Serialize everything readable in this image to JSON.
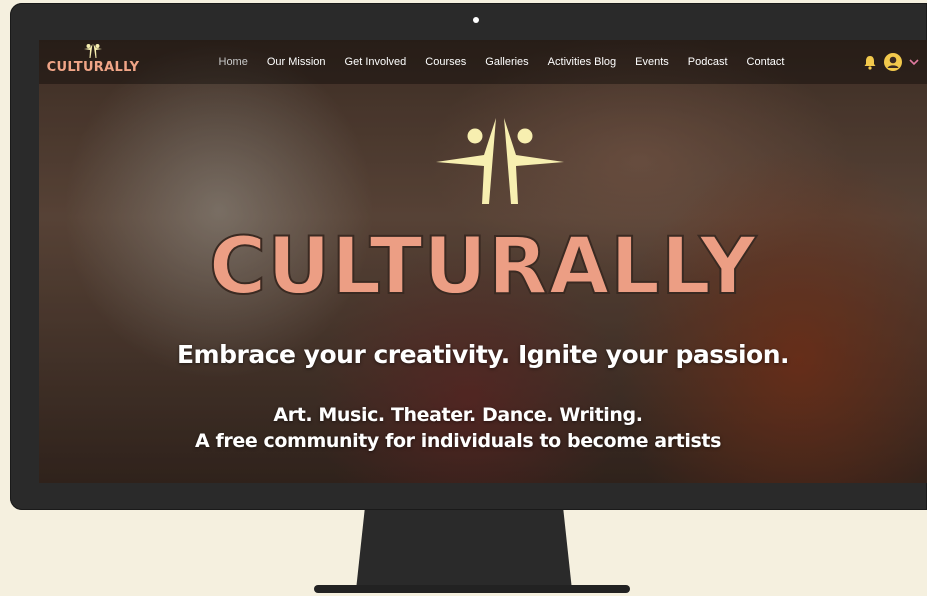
{
  "brand": {
    "name": "CULTURALLY"
  },
  "nav": {
    "items": [
      {
        "label": "Home",
        "active": true
      },
      {
        "label": "Our Mission"
      },
      {
        "label": "Get Involved"
      },
      {
        "label": "Courses"
      },
      {
        "label": "Galleries"
      },
      {
        "label": "Activities Blog"
      },
      {
        "label": "Events"
      },
      {
        "label": "Podcast"
      },
      {
        "label": "Contact"
      }
    ],
    "icons": [
      "bell-icon",
      "avatar-icon",
      "chevron-down-icon"
    ]
  },
  "hero": {
    "title": "CULTURALLY",
    "tagline": "Embrace your creativity. Ignite your passion.",
    "line1": "Art. Music. Theater. Dance. Writing.",
    "line2": "A free community for individuals to become artists"
  },
  "colors": {
    "accent": "#ec9e84",
    "logo_yellow": "#f7efb0",
    "bell": "#f2c94c",
    "chevron": "#e07aa0",
    "page_bg": "#f5f0df",
    "monitor": "#2a2a2a"
  }
}
